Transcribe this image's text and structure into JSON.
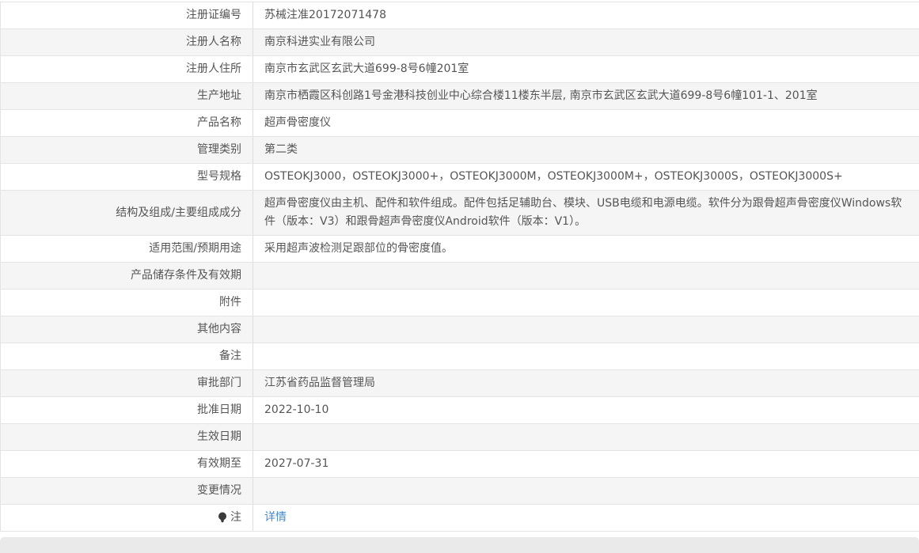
{
  "page": {
    "kind": "medical-device-registration-detail"
  },
  "colors": {
    "text": "#555555",
    "row_stripe": "#f5f5f5",
    "border": "#e4e4e4",
    "column_divider": "#dddddd",
    "link": "#428bca",
    "footer_bar": "#eaeaea",
    "note_icon": "#3a3a3a"
  },
  "table": {
    "rows": [
      {
        "label": "注册证编号",
        "value": "苏械注准20172071478"
      },
      {
        "label": "注册人名称",
        "value": "南京科进实业有限公司"
      },
      {
        "label": "注册人住所",
        "value": "南京市玄武区玄武大道699-8号6幢201室"
      },
      {
        "label": "生产地址",
        "value": "南京市栖霞区科创路1号金港科技创业中心综合楼11楼东半层, 南京市玄武区玄武大道699-8号6幢101-1、201室"
      },
      {
        "label": "产品名称",
        "value": "超声骨密度仪"
      },
      {
        "label": "管理类别",
        "value": "第二类"
      },
      {
        "label": "型号规格",
        "value": "OSTEOKJ3000，OSTEOKJ3000+，OSTEOKJ3000M，OSTEOKJ3000M+，OSTEOKJ3000S，OSTEOKJ3000S+"
      },
      {
        "label": "结构及组成/主要组成成分",
        "value": "超声骨密度仪由主机、配件和软件组成。配件包括足辅助台、模块、USB电缆和电源电缆。软件分为跟骨超声骨密度仪Windows软件（版本：V3）和跟骨超声骨密度仪Android软件（版本：V1）。"
      },
      {
        "label": "适用范围/预期用途",
        "value": "采用超声波检测足跟部位的骨密度值。"
      },
      {
        "label": "产品储存条件及有效期",
        "value": ""
      },
      {
        "label": "附件",
        "value": ""
      },
      {
        "label": "其他内容",
        "value": ""
      },
      {
        "label": "备注",
        "value": ""
      },
      {
        "label": "审批部门",
        "value": "江苏省药品监督管理局"
      },
      {
        "label": "批准日期",
        "value": "2022-10-10"
      },
      {
        "label": "生效日期",
        "value": ""
      },
      {
        "label": "有效期至",
        "value": "2027-07-31"
      },
      {
        "label": "变更情况",
        "value": ""
      },
      {
        "label": "注",
        "value": "详情",
        "icon": "note-bulb-icon",
        "link": true
      }
    ]
  }
}
